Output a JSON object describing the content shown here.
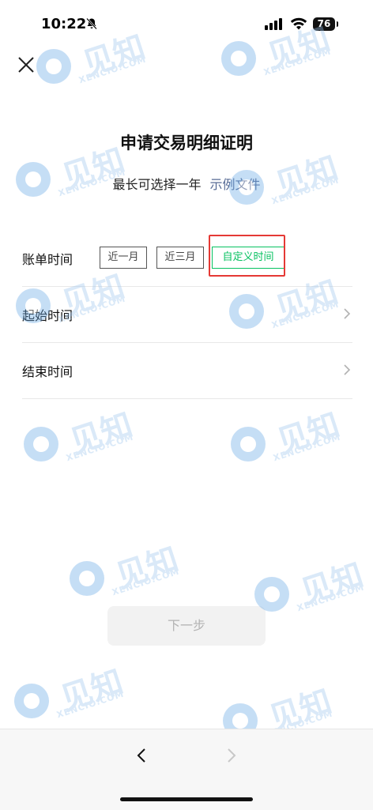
{
  "status_bar": {
    "time": "10:22",
    "battery": "76",
    "icons": [
      "bell-muted-icon",
      "cellular-signal-icon",
      "wifi-icon",
      "battery-icon"
    ]
  },
  "header": {
    "close_icon": "close-icon",
    "title": "申请交易明细证明",
    "subtitle": "最长可选择一年",
    "example_link": "示例文件"
  },
  "form": {
    "bill_time": {
      "label": "账单时间",
      "options": [
        "近一月",
        "近三月",
        "自定义时间"
      ],
      "selected": "自定义时间"
    },
    "start_time": {
      "label": "起始时间"
    },
    "end_time": {
      "label": "结束时间"
    }
  },
  "actions": {
    "next_label": "下一步"
  },
  "watermark": {
    "text": "见知",
    "sub": "XENCIO.COM"
  },
  "colors": {
    "accent_green": "#07c160",
    "link_blue": "#576b95",
    "highlight_red": "#e53935",
    "disabled_button": "#f2f2f2"
  }
}
